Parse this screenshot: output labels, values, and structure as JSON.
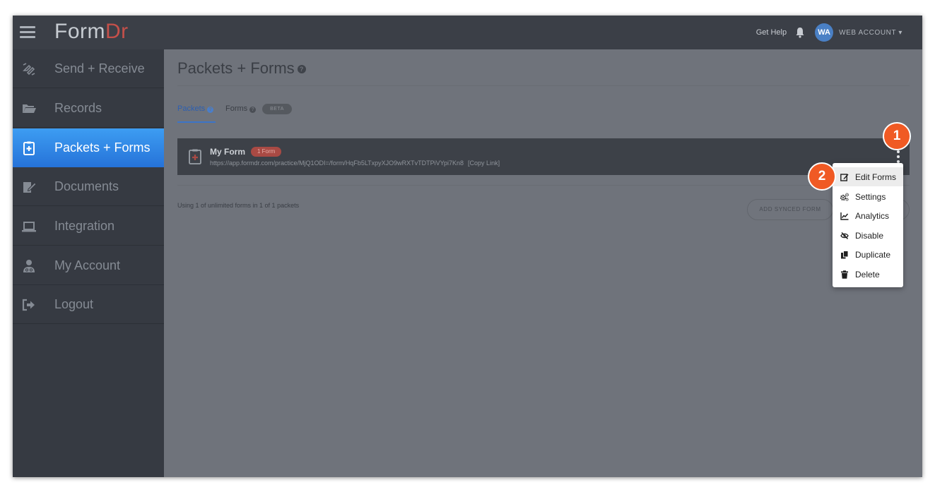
{
  "brand": {
    "logo_main": "Form",
    "logo_accent": "Dr"
  },
  "header": {
    "help": "Get Help",
    "avatar_initials": "WA",
    "account": "WEB ACCOUNT ▾"
  },
  "sidebar": {
    "items": [
      {
        "label": "Send + Receive",
        "icon": "send-receive-icon"
      },
      {
        "label": "Records",
        "icon": "folder-open-icon"
      },
      {
        "label": "Packets + Forms",
        "icon": "clipboard-plus-icon",
        "active": true
      },
      {
        "label": "Documents",
        "icon": "document-sign-icon"
      },
      {
        "label": "Integration",
        "icon": "laptop-icon"
      },
      {
        "label": "My Account",
        "icon": "user-doctor-icon"
      },
      {
        "label": "Logout",
        "icon": "sign-out-icon"
      }
    ]
  },
  "main": {
    "title": "Packets + Forms",
    "help_glyph": "?",
    "tabs": {
      "packets": "Packets",
      "forms": "Forms",
      "beta": "BETA"
    },
    "packet": {
      "name": "My Form",
      "badge": "1 Form",
      "url": "https://app.formdr.com/practice/MjQ1ODI=/form/HqFb5LTxpyXJO9wRXTvTDTPiVYpi7Kn8",
      "copy_link": "[Copy Link]"
    },
    "usage": "Using 1 of unlimited forms in 1 of 1 packets",
    "add_synced_form": "ADD SYNCED FORM"
  },
  "menu": {
    "items": [
      {
        "label": "Edit Forms",
        "icon": "edit-icon"
      },
      {
        "label": "Settings",
        "icon": "cogs-icon"
      },
      {
        "label": "Analytics",
        "icon": "chart-line-icon"
      },
      {
        "label": "Disable",
        "icon": "eye-slash-icon"
      },
      {
        "label": "Duplicate",
        "icon": "copy-icon"
      },
      {
        "label": "Delete",
        "icon": "trash-icon"
      }
    ]
  },
  "steps": {
    "one": "1",
    "two": "2"
  },
  "colors": {
    "accent_blue": "#2f80e0",
    "brand_red": "#c4504a",
    "step_orange": "#f05a24"
  }
}
